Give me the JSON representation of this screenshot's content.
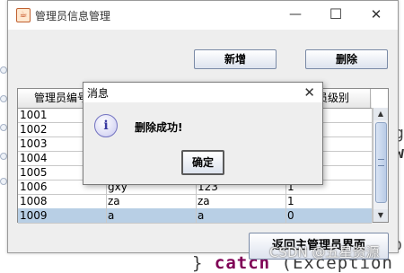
{
  "window": {
    "title": "管理员信息管理",
    "minimize": "—",
    "maximize": "☐",
    "close": "✕"
  },
  "toolbar": {
    "add_label": "新增",
    "delete_label": "删除"
  },
  "table": {
    "headers": [
      "管理员编号",
      "",
      "",
      "理员级别"
    ],
    "rows": [
      [
        "1001",
        "",
        "",
        ""
      ],
      [
        "1002",
        "",
        "",
        ""
      ],
      [
        "1003",
        "",
        "",
        ""
      ],
      [
        "1004",
        "",
        "",
        ""
      ],
      [
        "1005",
        "",
        "",
        ""
      ],
      [
        "1006",
        "gxy",
        "123",
        "1"
      ],
      [
        "1008",
        "za",
        "za",
        "1"
      ],
      [
        "1009",
        "a",
        "a",
        "0"
      ]
    ],
    "selected_row": 7
  },
  "back_button": {
    "label": "返回主管理员界面"
  },
  "dialog": {
    "title": "消息",
    "message": "删除成功!",
    "ok_label": "确定",
    "close": "✕",
    "icon_glyph": "i"
  },
  "background_code": {
    "glyph_g": "g",
    "glyph_w": "w",
    "glyph_p": "p",
    "catch_prefix": "} ",
    "catch_keyword": "catch",
    "catch_rest": " (Exception"
  },
  "watermark": "CSDN @五星资源",
  "colors": {
    "selection": "#b8cfe5",
    "window_bg": "#eeeeee"
  }
}
